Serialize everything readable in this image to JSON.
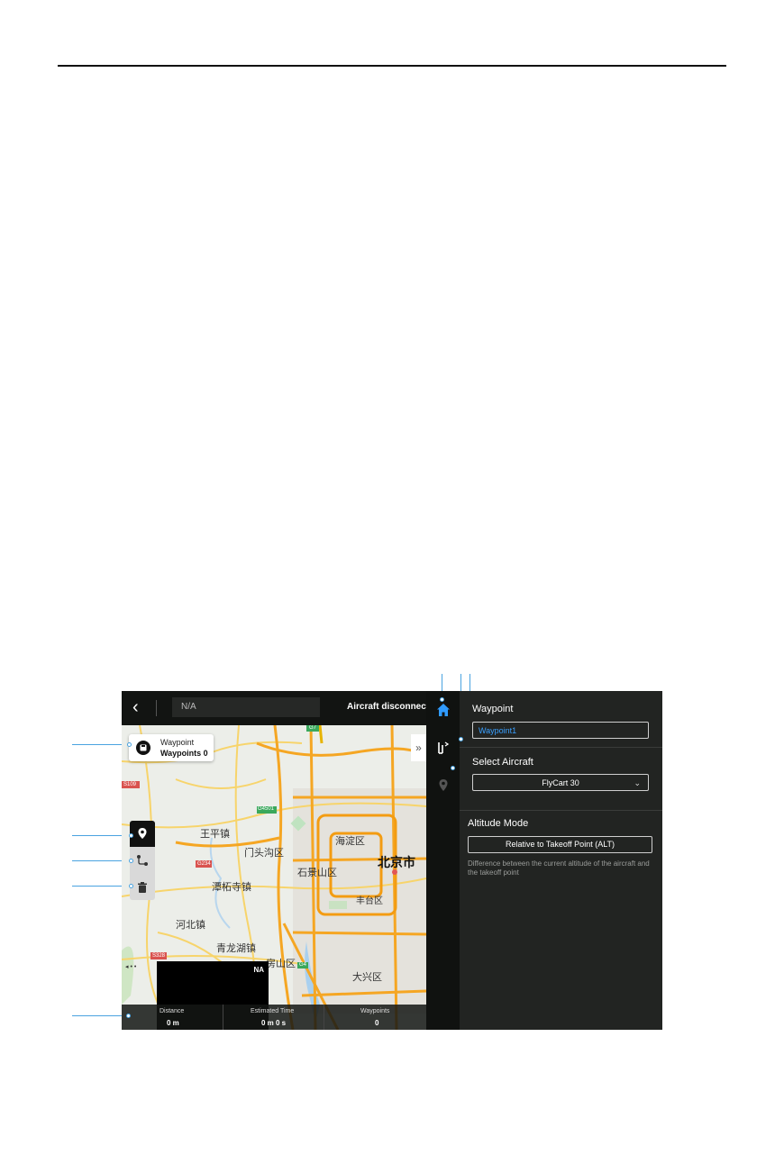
{
  "topbar": {
    "back_glyph": "‹",
    "mission_name": "N/A",
    "status": "Aircraft disconnected"
  },
  "waypoint_card": {
    "title": "Waypoint",
    "count_label": "Waypoints 0"
  },
  "map": {
    "expand_glyph": "»",
    "attribution": "◂ • •",
    "labels": [
      {
        "text": "王平镇"
      },
      {
        "text": "门头沟区"
      },
      {
        "text": "海淀区"
      },
      {
        "text": "北京市"
      },
      {
        "text": "石景山区"
      },
      {
        "text": "潭柘寺镇"
      },
      {
        "text": "丰台区"
      },
      {
        "text": "河北镇"
      },
      {
        "text": "青龙湖镇"
      },
      {
        "text": "房山区"
      },
      {
        "text": "大兴区"
      },
      {
        "text": "G4501"
      },
      {
        "text": "S109"
      },
      {
        "text": "G234"
      },
      {
        "text": "S328"
      },
      {
        "text": "G4"
      },
      {
        "text": "G7"
      }
    ]
  },
  "minimap": {
    "label": "NA"
  },
  "stats": [
    {
      "label": "Distance",
      "value": "0 m"
    },
    {
      "label": "Estimated Time",
      "value": "0 m 0 s"
    },
    {
      "label": "Waypoints",
      "value": "0"
    }
  ],
  "panel": {
    "waypoint_title": "Waypoint",
    "waypoint_name": "Waypoint1",
    "aircraft_title": "Select Aircraft",
    "aircraft_value": "FlyCart 30",
    "aircraft_chevron": "⌄",
    "altitude_title": "Altitude Mode",
    "altitude_value": "Relative to Takeoff Point (ALT)",
    "altitude_desc": "Difference between the current altitude of the aircraft and the takeoff point"
  },
  "colors": {
    "accent": "#2f9bff",
    "road_major": "#f5a623",
    "road_minor": "#f7d46b",
    "panel_bg": "#222422"
  }
}
